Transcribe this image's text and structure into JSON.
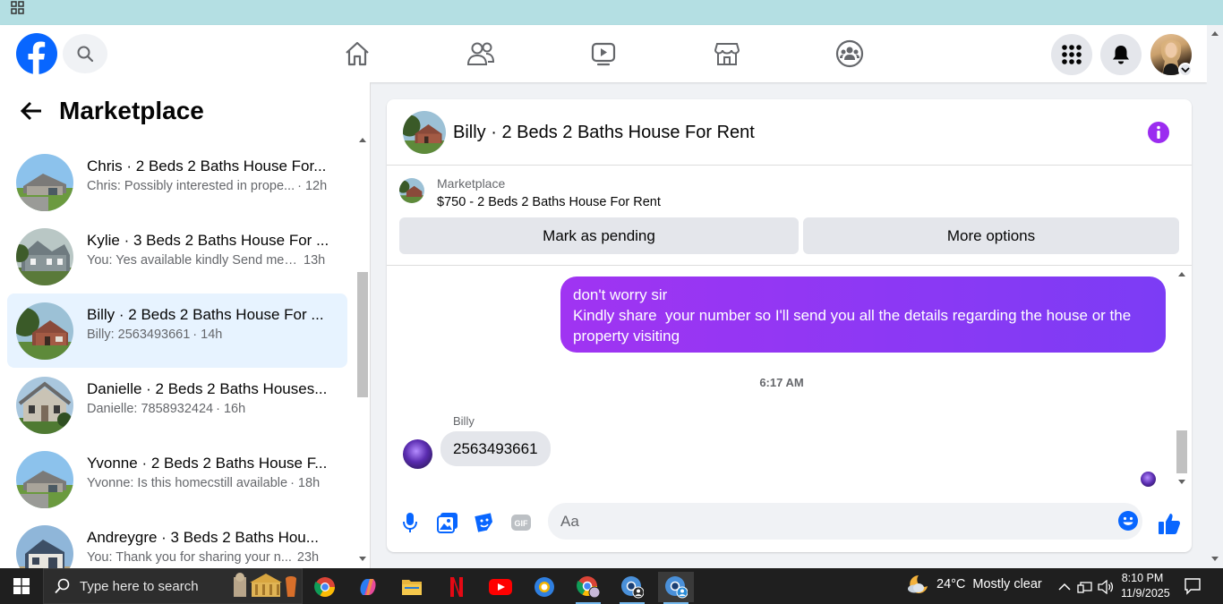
{
  "nav": {
    "icons": [
      "facebook-logo",
      "search-icon",
      "home-icon",
      "friends-icon",
      "watch-icon",
      "marketplace-icon",
      "groups-icon",
      "menu-grid-icon",
      "notifications-icon",
      "profile-avatar"
    ]
  },
  "left_panel": {
    "title": "Marketplace",
    "conversations": [
      {
        "title": "Chris · 2 Beds 2 Baths House For...",
        "snippet": "Chris: Possibly interested in prope...",
        "time": "· 12h"
      },
      {
        "title": "Kylie · 3 Beds 2 Baths House For ...",
        "snippet": "You: Yes available kindly Send me ...",
        "time": "13h"
      },
      {
        "title": "Billy · 2 Beds 2 Baths House For ...",
        "snippet": "Billy: 2563493661",
        "time": "· 14h"
      },
      {
        "title": "Danielle · 2 Beds 2 Baths Houses...",
        "snippet": "Danielle: 7858932424",
        "time": "· 16h"
      },
      {
        "title": "Yvonne · 2 Beds 2 Baths House F...",
        "snippet": "Yvonne: Is this homecstill available",
        "time": "· 18h"
      },
      {
        "title": "Andreygre · 3 Beds 2 Baths Hou...",
        "snippet": "You: Thank you for sharing your n...",
        "time": "23h"
      }
    ]
  },
  "chat": {
    "title": "Billy · 2 Beds 2 Baths House For Rent",
    "listing_source": "Marketplace",
    "listing_title": "$750 - 2 Beds 2 Baths House For Rent",
    "mark_pending_label": "Mark as pending",
    "more_options_label": "More options",
    "outgoing_lines": [
      "don't worry sir",
      "Kindly share  your number so I'll send you all the details regarding the house or the",
      "property visiting"
    ],
    "timestamp": "6:17 AM",
    "sender_name": "Billy",
    "incoming_text": "2563493661",
    "composer_placeholder": "Aa"
  },
  "taskbar": {
    "search_placeholder": "Type here to search",
    "weather_temp": "24°C",
    "weather_desc": "Mostly clear",
    "time": "8:10 PM",
    "date": "11/9/2025"
  },
  "colors": {
    "fb_blue": "#0866ff",
    "bubble_start": "#a034f2",
    "bubble_end": "#7c3cf5",
    "active_row": "#e7f3ff",
    "info_purple": "#9b2cf0"
  }
}
